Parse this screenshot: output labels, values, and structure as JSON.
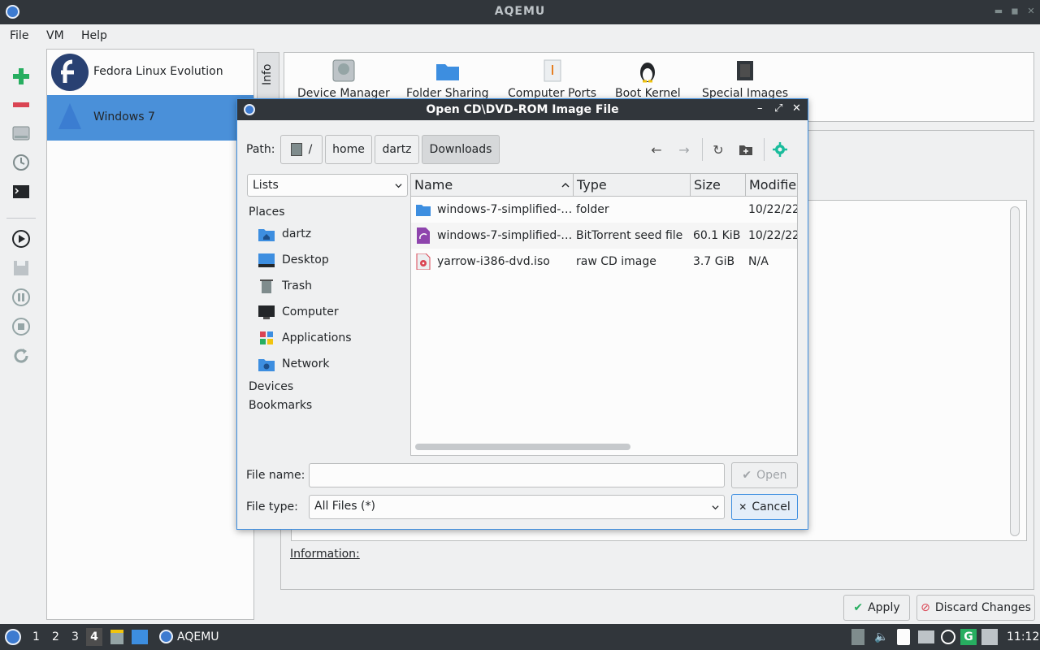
{
  "window": {
    "title": "AQEMU"
  },
  "menu": {
    "items": [
      "File",
      "VM",
      "Help"
    ]
  },
  "vms": [
    {
      "name": "Fedora Linux Evolution"
    },
    {
      "name": "Windows 7"
    }
  ],
  "info_tab": "Info",
  "devices": [
    "Device Manager",
    "Folder Sharing",
    "Computer Ports",
    "Boot Kernel",
    "Special Images"
  ],
  "information_label": "Information:",
  "buttons": {
    "apply": "Apply",
    "discard": "Discard Changes"
  },
  "dialog": {
    "title": "Open CD\\DVD-ROM Image File",
    "path_label": "Path:",
    "crumbs": [
      "/",
      "home",
      "dartz",
      "Downloads"
    ],
    "view_mode": "Lists",
    "sections": {
      "places": "Places",
      "devices": "Devices",
      "bookmarks": "Bookmarks"
    },
    "places": [
      "dartz",
      "Desktop",
      "Trash",
      "Computer",
      "Applications",
      "Network"
    ],
    "columns": [
      "Name",
      "Type",
      "Size",
      "Modified"
    ],
    "files": [
      {
        "name": "windows-7-simplified-…",
        "type": "folder",
        "size": "",
        "modified": "10/22/22"
      },
      {
        "name": "windows-7-simplified-…",
        "type": "BitTorrent seed file",
        "size": "60.1 KiB",
        "modified": "10/22/22"
      },
      {
        "name": "yarrow-i386-dvd.iso",
        "type": "raw CD image",
        "size": "3.7 GiB",
        "modified": "N/A"
      }
    ],
    "file_name_label": "File name:",
    "file_name_value": "",
    "file_type_label": "File type:",
    "file_type_value": "All Files (*)",
    "open_button": "Open",
    "cancel_button": "Cancel"
  },
  "taskbar": {
    "workspaces": [
      "1",
      "2",
      "3",
      "4"
    ],
    "active_workspace": "4",
    "task": "AQEMU",
    "clock": "11:12"
  },
  "colors": {
    "selection": "#4a90d9",
    "titlebar": "#31363b",
    "accent": "#3d8ee0"
  }
}
